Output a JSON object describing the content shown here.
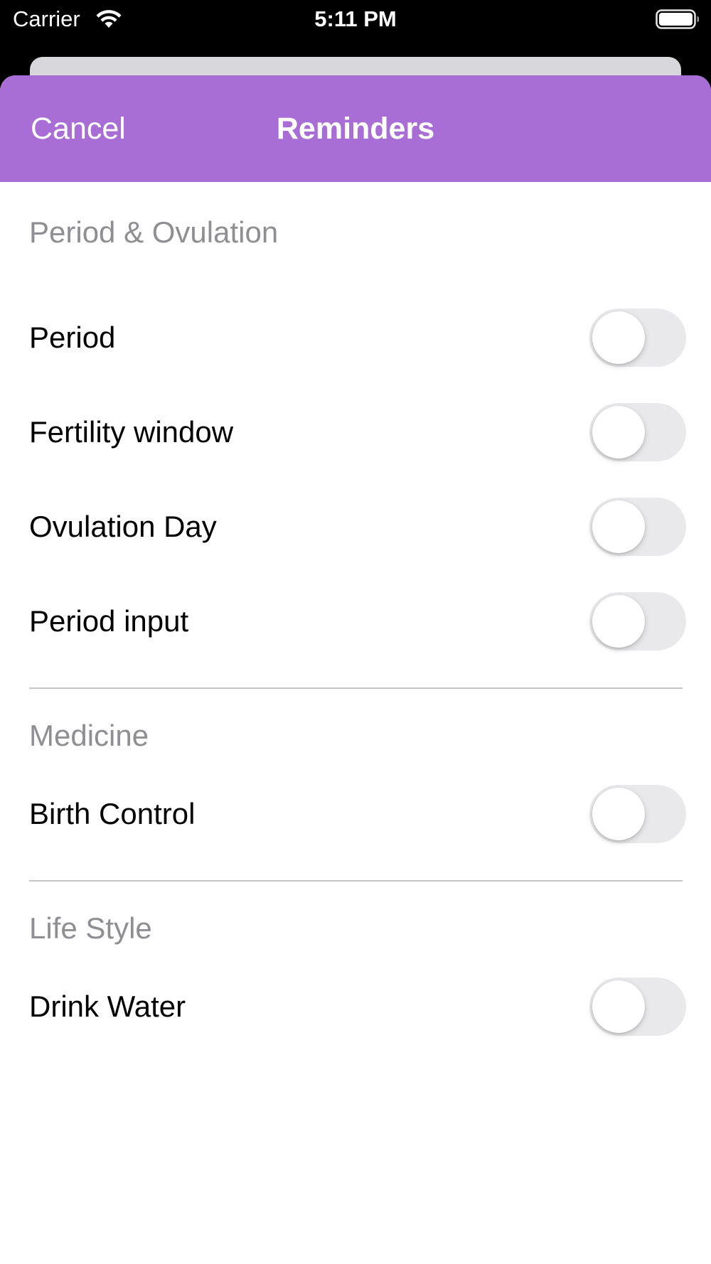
{
  "status_bar": {
    "carrier": "Carrier",
    "time": "5:11 PM",
    "wifi_icon": "wifi-icon",
    "battery_icon": "battery-full-icon"
  },
  "nav": {
    "cancel_label": "Cancel",
    "title": "Reminders",
    "background_color": "#a86ed5"
  },
  "sections": [
    {
      "header": "Period & Ovulation",
      "items": [
        {
          "label": "Period",
          "enabled": false
        },
        {
          "label": "Fertility window",
          "enabled": false
        },
        {
          "label": "Ovulation Day",
          "enabled": false
        },
        {
          "label": "Period input",
          "enabled": false
        }
      ]
    },
    {
      "header": "Medicine",
      "items": [
        {
          "label": "Birth Control",
          "enabled": false
        }
      ]
    },
    {
      "header": "Life Style",
      "items": [
        {
          "label": "Drink Water",
          "enabled": false
        }
      ]
    }
  ]
}
